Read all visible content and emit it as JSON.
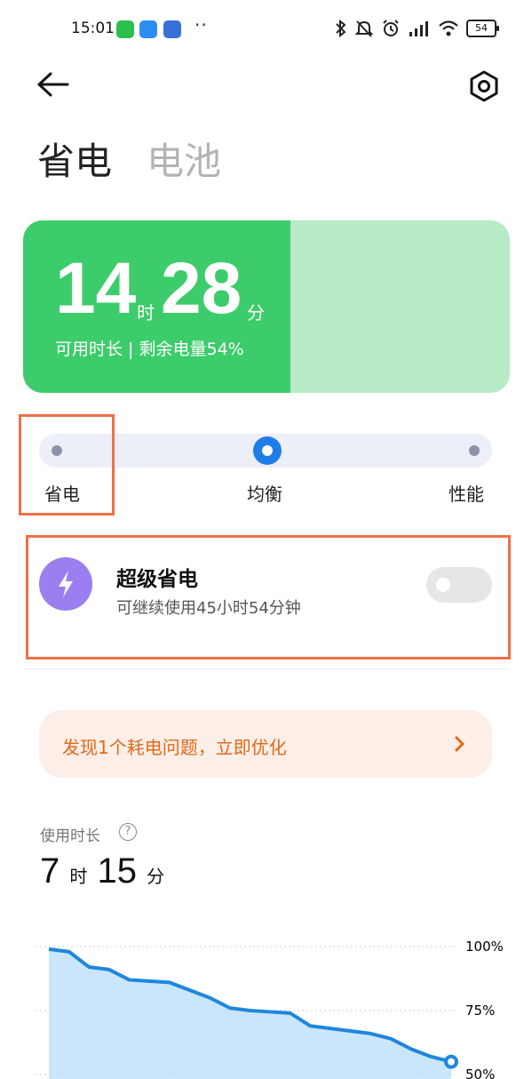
{
  "status_bar": {
    "time": "15:01",
    "dots": "··",
    "battery": "54"
  },
  "header": {
    "tabs": [
      "省电",
      "电池"
    ]
  },
  "battery_card": {
    "hours": "14",
    "hours_unit": "时",
    "minutes": "28",
    "minutes_unit": "分",
    "caption": "可用时长 | 剩余电量54%",
    "level_percent": 54
  },
  "mode_slider": {
    "options": [
      "省电",
      "均衡",
      "性能"
    ],
    "selected": "均衡"
  },
  "super_save": {
    "title": "超级省电",
    "subtitle": "可继续使用45小时54分钟",
    "enabled": false
  },
  "alert": {
    "text": "发现1个耗电问题，立即优化"
  },
  "usage": {
    "label": "使用时长",
    "hours": "7",
    "hours_unit": "时",
    "minutes": "15",
    "minutes_unit": "分"
  },
  "chart_data": {
    "type": "area",
    "ytick_labels": [
      "100%",
      "75%",
      "50%"
    ],
    "ylim": [
      50,
      100
    ],
    "x": [
      0,
      1,
      2,
      3,
      4,
      5,
      6,
      7,
      8,
      9,
      10,
      11,
      12,
      13,
      14,
      15,
      16,
      17,
      18,
      19,
      20
    ],
    "values": [
      99,
      98,
      92,
      91,
      87,
      86.5,
      86,
      83,
      80,
      76,
      75,
      74.5,
      74,
      69,
      68,
      67,
      66,
      64,
      60,
      57,
      55
    ],
    "grid": true,
    "colors": {
      "line": "#1f86de",
      "fill": "#bfe2fa"
    }
  },
  "colors": {
    "accent": "#1f7de8",
    "battery_green": "#3dcc6b",
    "battery_light": "#b6ebc5",
    "highlight": "#ef7046",
    "alert_text": "#e06a16",
    "bolt": "#9b7eef"
  },
  "icons": [
    "wechat-icon",
    "telegram-icon",
    "robot-app-icon",
    "bluetooth-icon",
    "mute-icon",
    "alarm-icon",
    "signal-icon",
    "wifi-icon",
    "back-arrow-icon",
    "settings-hex-icon",
    "bolt-icon",
    "chevron-right-icon",
    "help-icon"
  ]
}
